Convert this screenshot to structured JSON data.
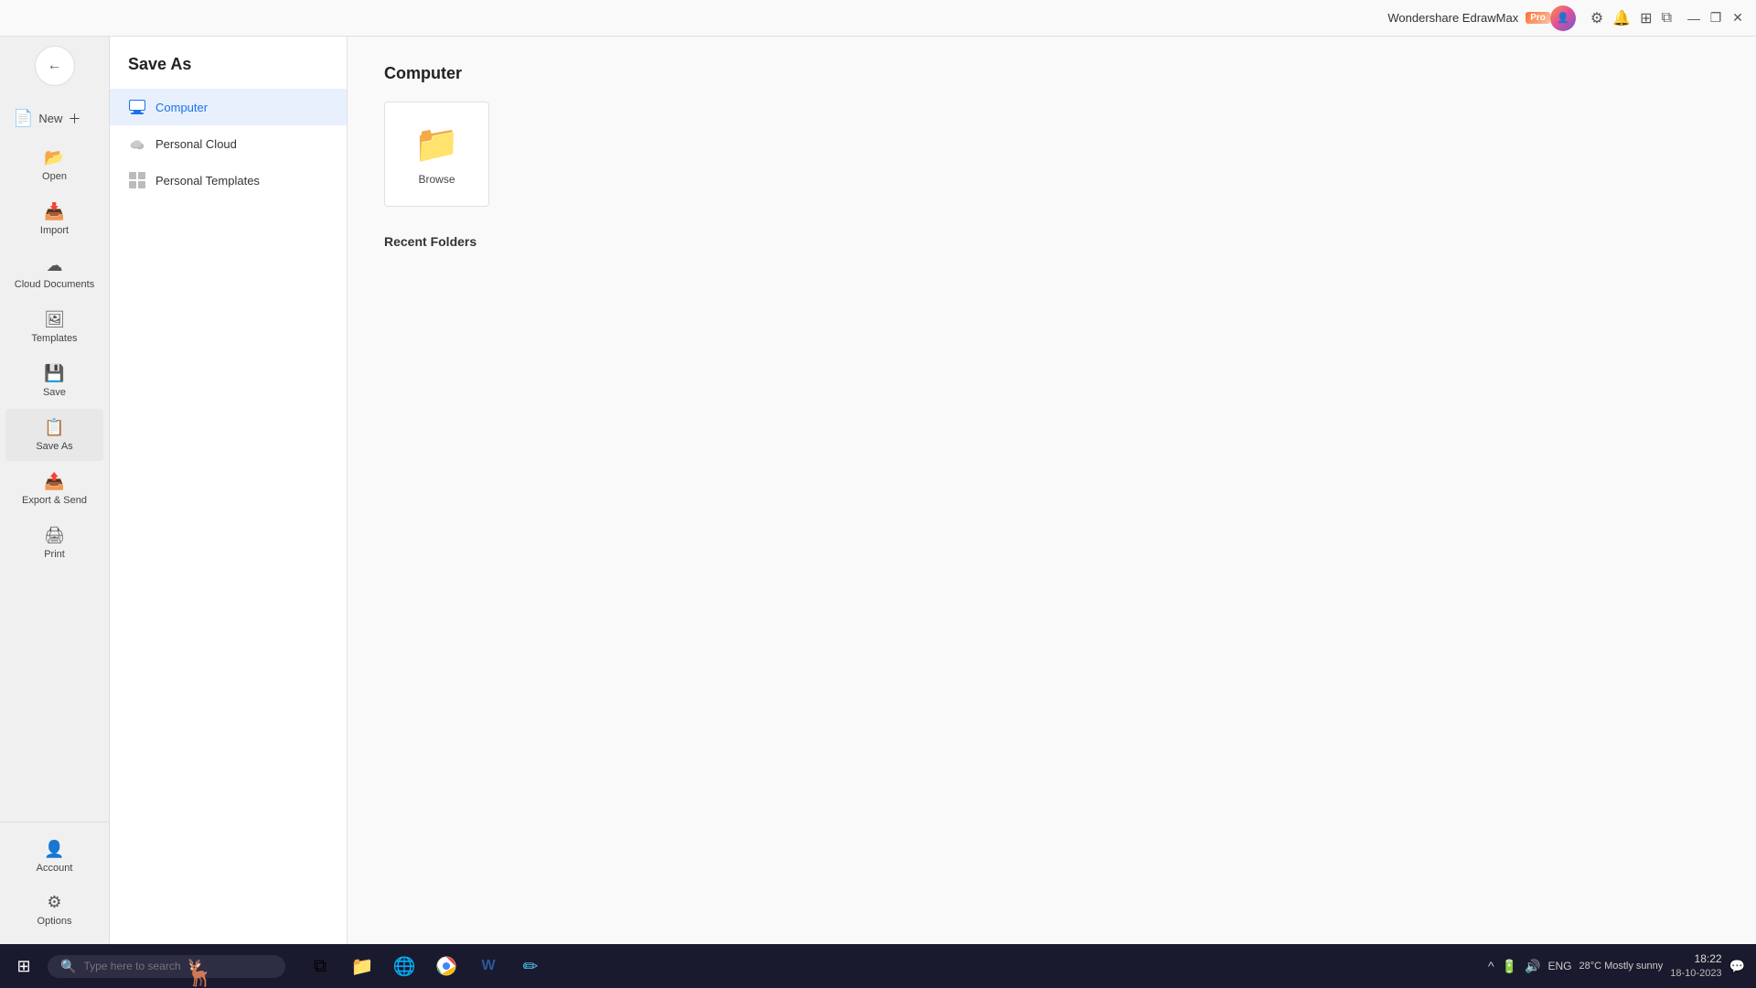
{
  "titleBar": {
    "appName": "Wondershare EdrawMax",
    "proBadge": "Pro",
    "windowButtons": {
      "minimize": "—",
      "restore": "❐",
      "close": "✕"
    }
  },
  "leftNav": {
    "backButton": "←",
    "items": [
      {
        "id": "new",
        "label": "New",
        "icon": "📄",
        "hasPlus": true
      },
      {
        "id": "open",
        "label": "Open",
        "icon": "📂"
      },
      {
        "id": "import",
        "label": "Import",
        "icon": "📥"
      },
      {
        "id": "cloud",
        "label": "Cloud Documents",
        "icon": "☁"
      },
      {
        "id": "templates",
        "label": "Templates",
        "icon": "🖼"
      },
      {
        "id": "save",
        "label": "Save",
        "icon": "💾"
      },
      {
        "id": "saveas",
        "label": "Save As",
        "icon": "📋",
        "active": true
      },
      {
        "id": "export",
        "label": "Export & Send",
        "icon": "📤"
      },
      {
        "id": "print",
        "label": "Print",
        "icon": "🖨"
      }
    ],
    "bottomItems": [
      {
        "id": "account",
        "label": "Account",
        "icon": "👤"
      },
      {
        "id": "options",
        "label": "Options",
        "icon": "⚙"
      }
    ]
  },
  "saveAsPanel": {
    "title": "Save As",
    "options": [
      {
        "id": "computer",
        "label": "Computer",
        "active": true
      },
      {
        "id": "personal-cloud",
        "label": "Personal Cloud"
      },
      {
        "id": "personal-templates",
        "label": "Personal Templates"
      }
    ]
  },
  "mainContent": {
    "sectionTitle": "Computer",
    "browseCard": {
      "icon": "📁",
      "label": "Browse"
    },
    "recentFolders": {
      "title": "Recent Folders"
    }
  },
  "taskbar": {
    "startIcon": "⊞",
    "searchPlaceholder": "Type here to search",
    "apps": [
      {
        "id": "task-view",
        "icon": "⧉"
      },
      {
        "id": "file-explorer",
        "icon": "📁"
      },
      {
        "id": "edge",
        "icon": "🌐"
      },
      {
        "id": "chrome",
        "icon": "◉"
      },
      {
        "id": "word",
        "icon": "W"
      },
      {
        "id": "edrawmax",
        "icon": "✏"
      }
    ],
    "systemTray": {
      "weather": "28°C  Mostly sunny",
      "chevron": "^",
      "time": "18:22",
      "date": "18-10-2023",
      "lang": "ENG"
    }
  }
}
